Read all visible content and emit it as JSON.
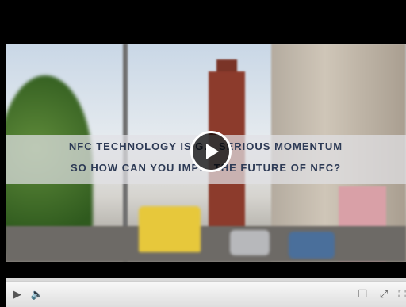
{
  "video": {
    "caption_line1": "NFC TECHNOLOGY IS G… SERIOUS MOMENTUM",
    "caption_line2": "SO HOW CAN YOU IMP… THE FUTURE OF NFC?"
  },
  "player": {
    "progress_fraction": 0.0,
    "accent_color": "#d51c1c",
    "icons": {
      "big_play": "play-icon",
      "play": "play-icon",
      "volume": "volume-icon",
      "popout": "popout-icon",
      "expand": "expand-icon",
      "fullscreen": "fullscreen-icon"
    }
  }
}
